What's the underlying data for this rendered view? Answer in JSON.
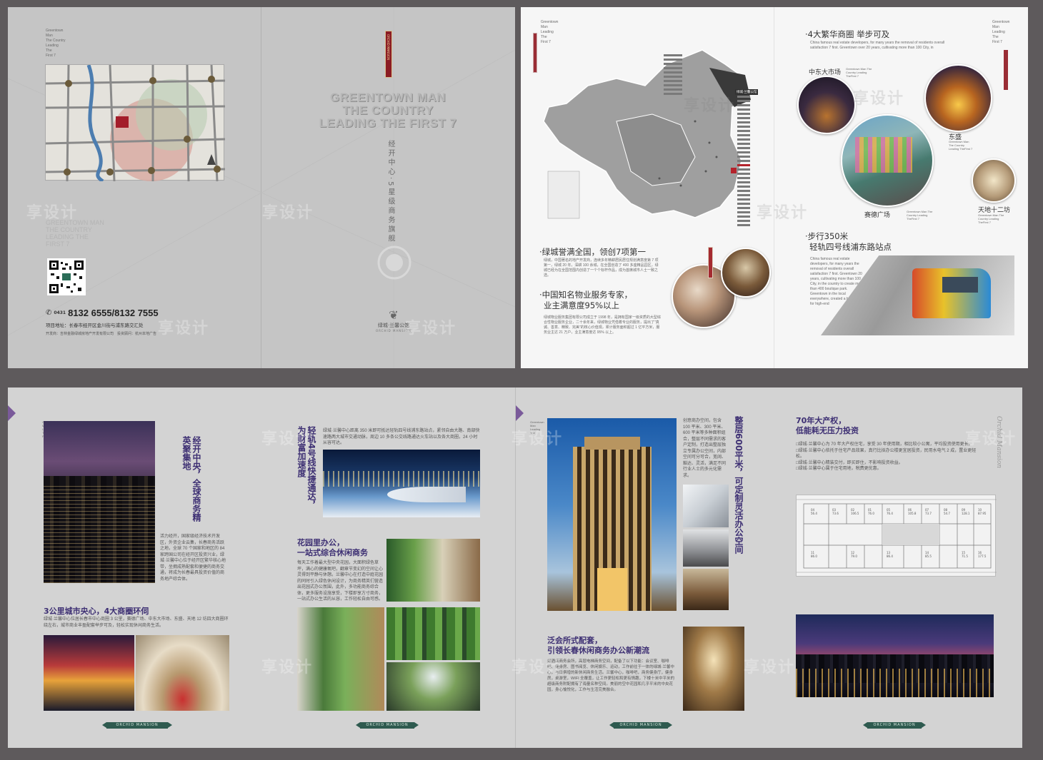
{
  "spread1": {
    "left_cover": {
      "small_en": [
        "Greentown",
        "Man",
        "The Country",
        "Leading",
        "The",
        "First 7"
      ],
      "en_block": [
        "GREENTOWN MAN",
        "THE COUNTRY",
        "LEADING THE",
        "FIRST 7"
      ],
      "phone_prefix": "0431",
      "phone": "8132 6555/8132 7555",
      "address": "项目地址：长春市经开区金川街与浦东路交汇处",
      "developer": "开发商：吉林金融绿城房地产开发有限公司　投资顾问：杭州本地广告"
    },
    "right_cover": {
      "ribbon": "ORCHID MANSION",
      "title_lines": [
        "GREENTOWN MAN",
        "THE COUNTRY",
        "LEADING THE FIRST 7"
      ],
      "vertical_slogan": "经开中心·5星级商务旗舰",
      "brand_cn": "绿城·兰馨公馆",
      "brand_en": "ORCHID MANSION"
    }
  },
  "spread2": {
    "left": {
      "small_en": [
        "Greentown",
        "Man",
        "Leading",
        "The",
        "First 7"
      ],
      "map_callout": "绿城·兰馨公馆",
      "heading1": "·绿城誉满全国，领创7项第一",
      "body1": "绿城，中国著名的地产开发商，连续多年精耕居民居住规划满意度第 7 项第一，绿城 20 年，深耕 100 余城，在全国创造了 400 多座精品园区，绿城已经为在全国范围内创造了一个个标杆作品，成为首席城市人士一致之选。",
      "heading2a": "·中国知名物业服务专家，",
      "heading2b": "业主满意度95%以上",
      "body2": "绿城物业服务集团有限公司成立于 1998 年，是拥有国家一级资质的大型综合性物业服务企业，二十余年来，绿城物业凭借着专业的服务，提出了\"真诚、善意、精致、完美\"的核心价值观，累计服务面积超过 1 亿平方米，服务业主达 21 万户，业主满意度达 95% 以上。"
    },
    "right": {
      "heading1": "·4大繁华商圈  举步可及",
      "en1": "China famous real estate developers, for many years the removal of residents overall satisfaction 7 first. Greentown over 20 years, cultivating more than 100 City, in",
      "labels": [
        "中东大市场",
        "东盛",
        "赛德广场",
        "天地十二坊"
      ],
      "label_en": "Greentown Man The Country Leading TheFirst 7",
      "heading2a": "·步行350米",
      "heading2b": "轻轨四号线浦东路站点",
      "en2": "China famous real estate developers, for many years the removal of residents overall satisfaction 7 first. Greentown 20 years, cultivating more than 100 City, in the country to create more than 400 boutique park. Greentown in the local everywhere, created a benchmark for high-end"
    }
  },
  "spread3": {
    "p1": {
      "vertical_heading": "经开中央，全球商务精英聚集地",
      "body": "活力经开，国家级经济技术开发区，外资企业云集，长春商务活跃之地，全球 70 个国家和地区的 84 家跨国公司在经开区投资兴业，绿城·兰馨中心位于经开区繁华核心地带，坐拥成熟配套和便捷的商务交通，将成为长春最具投资价值的商务地产综合体。",
      "heading2": "3公里城市央心，4大商圈环伺",
      "body2": "绿城·兰馨中心位居长春市中心商圈 3 公里，赛德广场、中东大市场、东盛、天地 12 坊四大商圈环绕左右，城市商业丰盈配套举步可及，轻松实现休闲商务生活。",
      "ribbon": "ORCHID MANSION"
    },
    "p2": {
      "vertical_heading": "轻轨4号线快捷通达，为财富加速度",
      "body": "绿城·兰馨中心距离 350 米即可抵达轻轨四号线浦东路站点，紧邻自由大路、南部快速路两大城市交通动脉，周边 10 多条公交线路通达火车站以及各大商圈，24 小时从容可达。",
      "heading2a": "花园里办公，",
      "heading2b": "一站式综合休闲商务",
      "body2": "每天工作着最大型中央花园，大面积绿色草坪，满心的健康氧吧，翻章节变幻的空间让心灵得到平静与休憩。兰馨中心在打造中庭花园的同时引入绿色休闲设计，为商务精英们营造出花园式办公氛围，此外，多功能商务综合体，更多服务设施享受，下楼即享方寸商务，一站式办公生活的从容，工作轻松自由可感。",
      "ribbon": "ORCHID MANSION"
    },
    "p3": {
      "vertical_heading": "整层600平米，可定制灵活办公空间",
      "body": "创意商办空间，包含 100 平米、300 平米、600 平米等多种面积组合，整层不同需求的客户定制，打造出整层独立专属办公空间，内部空间可分可合，宽阔、豁达、灵活，满足不同行业人士的多元化需求。",
      "heading2a": "泛会所式配套，",
      "heading2b": "引领长春休闲商务办公新潮流",
      "body2": "如酒店商务会所，高层电梯商务空间，配备了以下功能：会议室、咖啡吧、健身房、图书阅览、休闲娱乐、运动，工作前往于一体的绿城·兰馨中心，与日俱增的新休闲商务生活。兰馨中心，咖啡吧，商务健身厅，健身房，桌游室，WIFI 全覆盖，让工作更轻松和更有情趣，下楼十米中平米的超级商务附配拥有了海量名种空间。美丽的空中花园和几乎平米的中央花园，身心愉悦化，工作与生活完美融合。",
      "ribbon": "ORCHID MANSION"
    },
    "p4": {
      "heading_a": "70年大产权，",
      "heading_b": "低能耗无压力投资",
      "bullets": [
        "□绿城·兰馨中心为 70 年大产权住宅，享受 30 年使用期，相比较小公寓，平均投资使用更长。",
        "□绿城·兰馨中心依托于住宅产品效果，真行比拟办公楼更宜居投资，民用水电气 2 成，置业更轻松。",
        "□绿城·兰馨中心精装交付，即买即住，不影响投资收益。",
        "□绿城·兰馨中心属于住宅用地，税费更优惠。"
      ],
      "floor_units": [
        "04\n56.4",
        "03\n73.6",
        "02\n106.5",
        "01\n76.0",
        "05\n76.4",
        "06\n105.8",
        "07\n73.7",
        "08\n54.7",
        "09\n128.1",
        "10\n87.95",
        "11\n86.0",
        "12\n79.0",
        "13\n86.4",
        "14\n85.5",
        "15\n71.5",
        "16\n177.5"
      ],
      "en_vertical": "Orchid Mansion",
      "ribbon": "ORCHID MANSION"
    }
  },
  "watermark": "享设计"
}
